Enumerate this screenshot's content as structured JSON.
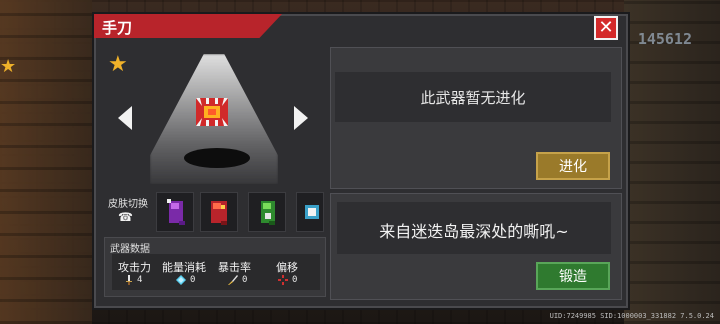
{
  "window": {
    "title": "手刀",
    "close_symbol": "✕"
  },
  "hud": {
    "score": "145612",
    "uid_text": "UID:7249985 SID:1000003_331882 7.5.0.24"
  },
  "weapon": {
    "evolution_text": "此武器暂无进化",
    "description": "来自迷迭岛最深处的嘶吼~",
    "evolve_label": "进化",
    "forge_label": "锻造"
  },
  "skins": {
    "label": "皮肤切换"
  },
  "stats": {
    "title": "武器数据",
    "items": [
      {
        "label": "攻击力",
        "value": "4",
        "icon": "sword-icon"
      },
      {
        "label": "能量消耗",
        "value": "0",
        "icon": "energy-crystal-icon"
      },
      {
        "label": "暴击率",
        "value": "0",
        "icon": "crit-icon"
      },
      {
        "label": "偏移",
        "value": "0",
        "icon": "crosshair-icon"
      }
    ]
  },
  "colors": {
    "title_tab": "#b8242b",
    "close_button": "#d42a2a",
    "evolve_button": "#9a7a2a",
    "forge_button": "#2f7a2f",
    "star": "#f0b22a"
  }
}
